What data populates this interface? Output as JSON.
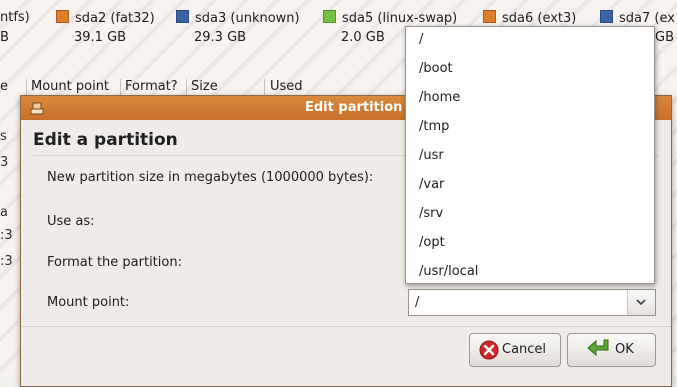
{
  "background": {
    "partitions": [
      {
        "label": "ntfs)",
        "size": "B",
        "color": ""
      },
      {
        "label": "sda2 (fat32)",
        "size": "39.1 GB",
        "color": "#e07d2a"
      },
      {
        "label": "sda3 (unknown)",
        "size": "29.3 GB",
        "color": "#3a64a8"
      },
      {
        "label": "sda5 (linux-swap)",
        "size": "2.0 GB",
        "color": "#74c043"
      },
      {
        "label": "sda6 (ext3)",
        "size": "",
        "color": "#e07d2a"
      },
      {
        "label": "sda7 (ex",
        "size": "GB",
        "color": "#3a64a8"
      }
    ],
    "table_headers": [
      "e",
      "Mount point",
      "Format?",
      "Size",
      "Used"
    ],
    "left_edge": [
      "s",
      "3",
      "a",
      ":3",
      ":3"
    ]
  },
  "dialog": {
    "window_title": "Edit partition",
    "heading": "Edit a partition",
    "size_label": "New partition size in megabytes (1000000 bytes):",
    "use_as_label": "Use as:",
    "format_label": "Format the partition:",
    "mount_label": "Mount point:",
    "mount_value": "/",
    "cancel_label": "Cancel",
    "ok_label": "OK"
  },
  "popup": {
    "options": [
      "/",
      "/boot",
      "/home",
      "/tmp",
      "/usr",
      "/var",
      "/srv",
      "/opt",
      "/usr/local"
    ]
  },
  "colors": {
    "titlebar": "#c9702a",
    "ok_icon": "#5aa73a",
    "cancel_icon": "#cc2a2a"
  }
}
